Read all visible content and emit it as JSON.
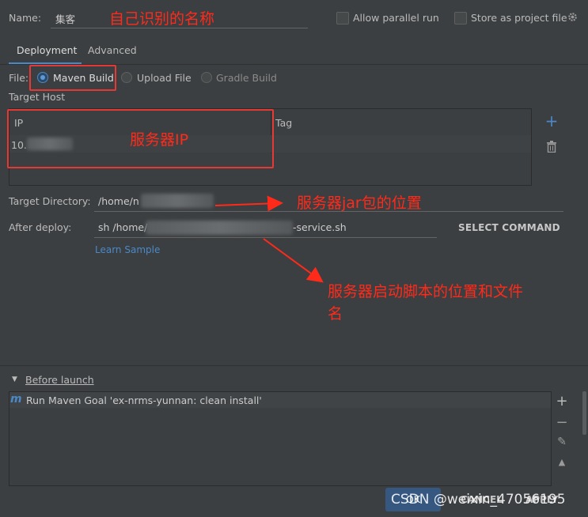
{
  "name": {
    "label": "Name:",
    "value": "集客"
  },
  "options": {
    "allow_parallel": "Allow parallel run",
    "store_as_project": "Store as project file"
  },
  "tabs": [
    {
      "label": "Deployment"
    },
    {
      "label": "Advanced"
    }
  ],
  "file": {
    "label": "File:",
    "options": [
      "Maven Build",
      "Upload File",
      "Gradle Build"
    ],
    "selected": "Maven Build"
  },
  "target_host": {
    "label": "Target Host",
    "columns": [
      "IP",
      "Tag"
    ],
    "rows": [
      {
        "ip": "10.",
        "tag": ""
      }
    ]
  },
  "target_directory": {
    "label": "Target Directory:",
    "value": "/home/n"
  },
  "after_deploy": {
    "label": "After deploy:",
    "value_start": "sh /home/",
    "value_end": "-service.sh"
  },
  "select_command": "SELECT COMMAND",
  "learn_sample": "Learn Sample",
  "before_launch": {
    "label": "Before launch",
    "items": [
      {
        "icon": "m",
        "text": "Run Maven Goal 'ex-nrms-yunnan: clean install'"
      }
    ]
  },
  "buttons": {
    "ok": "OK",
    "cancel": "CANCEL",
    "apply": "APPLY"
  },
  "watermark": "CSDN @weixin_47056195",
  "annotations": {
    "name": "自己识别的名称",
    "server_ip": "服务器IP",
    "jar_location": "服务器jar包的位置",
    "script_line1": "服务器启动脚本的位置和文件",
    "script_line2": "名"
  },
  "colors": {
    "accent": "#4a88c7",
    "annotation": "#ff2a1a",
    "background": "#3c3f41"
  }
}
